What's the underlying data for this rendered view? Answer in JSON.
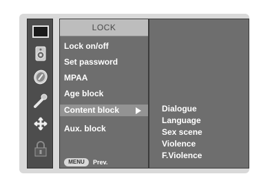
{
  "sidebar": {
    "icons": [
      "picture-icon",
      "sound-icon",
      "time-icon",
      "special-icon",
      "screen-icon",
      "lock-icon"
    ]
  },
  "menu": {
    "title": "LOCK",
    "items": [
      {
        "label": "Lock on/off"
      },
      {
        "label": "Set password"
      },
      {
        "label": "MPAA"
      },
      {
        "label": "Age block"
      },
      {
        "label": "Content block"
      },
      {
        "label": "Aux. block"
      }
    ],
    "selected_label": "Content block",
    "footer": {
      "key_label": "MENU",
      "action_label": "Prev."
    }
  },
  "submenu": {
    "items": [
      {
        "label": "Dialogue"
      },
      {
        "label": "Language"
      },
      {
        "label": "Sex scene"
      },
      {
        "label": "Violence"
      },
      {
        "label": "F.Violence"
      }
    ]
  },
  "colors": {
    "panel": "#6e6e6e",
    "highlight": "#939393",
    "title_bar": "#bdbdbd",
    "frame": "#d9d9d9"
  }
}
